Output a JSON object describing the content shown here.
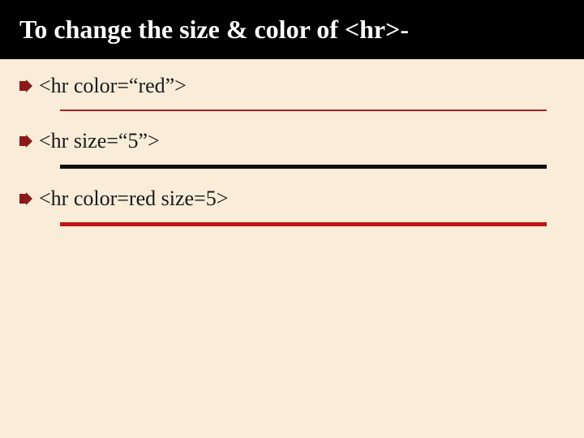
{
  "title": "To change the size & color of <hr>-",
  "items": [
    {
      "label": "<hr color=“red”>"
    },
    {
      "label": "<hr size=“5”>"
    },
    {
      "label": "<hr color=red  size=5>"
    }
  ]
}
